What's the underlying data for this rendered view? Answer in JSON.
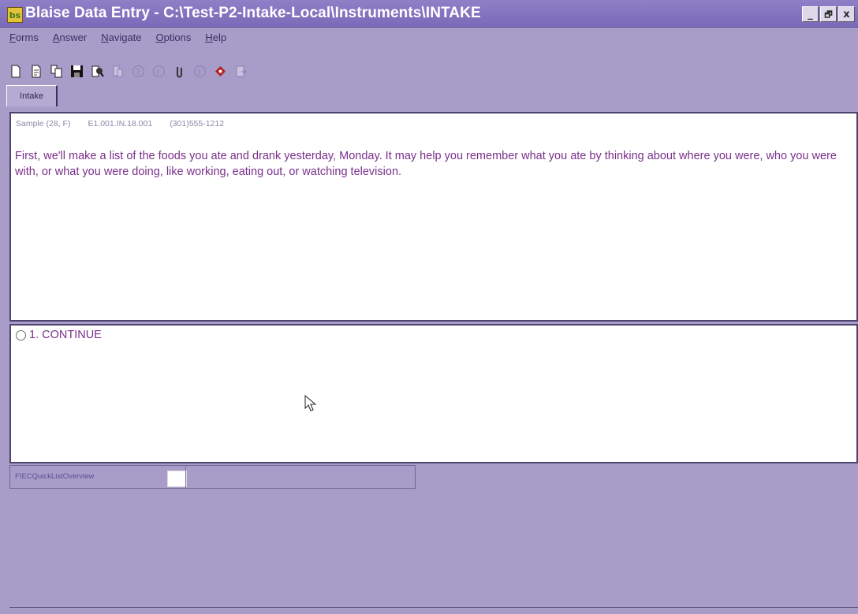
{
  "window": {
    "title": "Blaise Data Entry - C:\\Test-P2-Intake-Local\\Instruments\\INTAKE",
    "app_icon": "blaise-app-icon",
    "controls": [
      "_",
      "🗗",
      "x"
    ]
  },
  "menu": {
    "items": [
      {
        "label": "Forms",
        "mnemonic": "F"
      },
      {
        "label": "Answer",
        "mnemonic": "A"
      },
      {
        "label": "Navigate",
        "mnemonic": "N"
      },
      {
        "label": "Options",
        "mnemonic": "O"
      },
      {
        "label": "Help",
        "mnemonic": "H"
      }
    ]
  },
  "toolbar": {
    "icons": [
      "new-form-icon",
      "open-form-icon",
      "copy-form-icon",
      "save-icon",
      "find-icon",
      "lookup-icon",
      "help-icon",
      "info-icon",
      "attach-icon",
      "info-circle-icon",
      "remark-icon",
      "exit-icon"
    ]
  },
  "tabs": [
    {
      "label": "Intake"
    }
  ],
  "info_panel": {
    "sample": "Sample (28, F)",
    "case_id": "E1.001.IN.18.001",
    "phone": "(301)555-1212",
    "question": "First, we'll make a list of the foods you ate and drank yesterday, Monday.  It may help you remember what you ate by thinking about where you were, who you were with, or what you were doing, like working, eating out, or watching television."
  },
  "answer_panel": {
    "options": [
      {
        "label": "1.  CONTINUE"
      }
    ]
  },
  "field": {
    "label": "FIECQuickListOverview",
    "value": ""
  },
  "colors": {
    "background": "#a89cc8",
    "title_bar": "#7a6ab8",
    "question_text": "#7a2f8c"
  }
}
